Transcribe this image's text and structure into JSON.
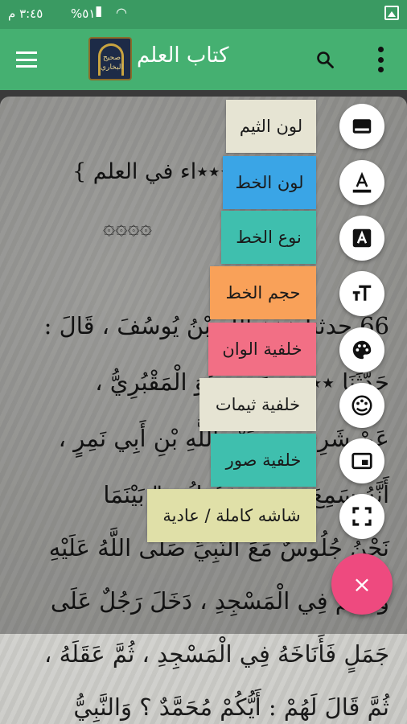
{
  "status_bar": {
    "time": "٣:٤٥ م",
    "battery": "%٥١"
  },
  "app_bar": {
    "title": "كتاب العلم",
    "logo_text": "صحيح البخاري"
  },
  "content": {
    "heading": "{ فضل من فعل … جاء في العلم }",
    "heading_visible": "{ ٭٭٭٭٭٭٭اء في العلم }",
    "lines": [
      "66 حدثنا ٭٭٭ اللهِ بْنُ يُوسُفَ ، قَالَ :",
      "حَدَّثَنَا ٭٭٭٭ سَعِيدٍ هُوَ الْمَقْبُرِيُّ ،",
      "عَنْ شَرِ٭٭٭٭ عَبْدِ اللَّهِ بْنِ أَبِي نَمِرٍ ،",
      "أَنَّهُ سَمِعَ ٭٭٭٭٭ يَقُولُ : \" بَيْنَمَا",
      "نَحْنُ جُلُوسٌ مَعَ النَّبِيِّ صَلَّى اللَّهُ عَلَيْهِ",
      "وَسَلَّمَ فِي الْمَسْجِدِ ، دَخَلَ رَجُلٌ عَلَى",
      "جَمَلٍ فَأَنَاخَهُ فِي الْمَسْجِدِ ، ثُمَّ عَقَلَهُ ،",
      "ثُمَّ قَالَ لَهُمْ : أَيُّكُمْ مُحَمَّدٌ ؟ وَالنَّبِيُّ"
    ]
  },
  "menu": {
    "items": [
      {
        "label": "لون الثيم",
        "color": "#e6e4d3",
        "icon": "subtitles-icon"
      },
      {
        "label": "لون الخط",
        "color": "#3aa5e6",
        "icon": "text-color-icon"
      },
      {
        "label": "نوع الخط",
        "color": "#3fbfae",
        "icon": "font-type-icon"
      },
      {
        "label": "حجم الخط",
        "color": "#f9a159",
        "icon": "text-size-icon"
      },
      {
        "label": "خلفية الوان",
        "color": "#f26f85",
        "icon": "palette-icon"
      },
      {
        "label": "خلفية ثيمات",
        "color": "#e6e4d3",
        "icon": "theme-icon"
      },
      {
        "label": "خلفية صور",
        "color": "#3fbfae",
        "icon": "picture-icon"
      },
      {
        "label": "شاشه كاملة / عادية",
        "color": "#e0e0a8",
        "icon": "fullscreen-icon"
      }
    ],
    "close_label": "×",
    "close_color": "#ee4a7f"
  },
  "colors": {
    "status_bar": "#3a9a62",
    "app_bar": "#45b071"
  }
}
